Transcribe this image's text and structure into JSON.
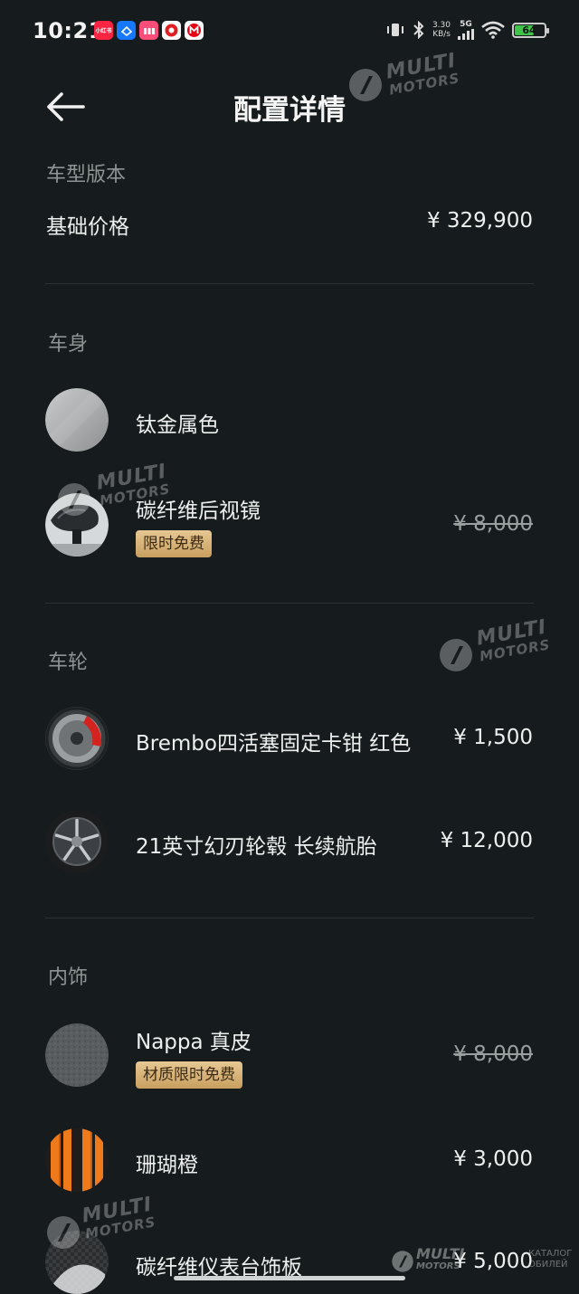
{
  "status_bar": {
    "time": "10:21",
    "apps": [
      {
        "name": "小红书",
        "color": "#ff2442"
      },
      {
        "name": "APP",
        "color": "#1677ff"
      },
      {
        "name": "app",
        "color": "#ff4d7a"
      },
      {
        "name": "app",
        "color": "#e02020"
      },
      {
        "name": "M",
        "color": "#e60012"
      }
    ],
    "net_speed_top": "3.30",
    "net_speed_unit": "KB/s",
    "signal": "5G",
    "battery": "64"
  },
  "header": {
    "title": "配置详情"
  },
  "trim": {
    "section": "车型版本",
    "base_price_label": "基础价格",
    "base_price": "¥ 329,900"
  },
  "body": {
    "section": "车身",
    "items": [
      {
        "label": "钛金属色",
        "price": ""
      },
      {
        "label": "碳纤维后视镜",
        "price": "¥ 8,000",
        "badge": "限时免费"
      }
    ]
  },
  "wheels": {
    "section": "车轮",
    "items": [
      {
        "label": "Brembo四活塞固定卡钳 红色",
        "price": "¥ 1,500"
      },
      {
        "label": "21英寸幻刃轮毂 长续航胎",
        "price": "¥ 12,000"
      }
    ]
  },
  "interior": {
    "section": "内饰",
    "items": [
      {
        "label": "Nappa 真皮",
        "price": "¥ 8,000",
        "badge": "材质限时免费"
      },
      {
        "label": "珊瑚橙",
        "price": "¥ 3,000"
      },
      {
        "label": "碳纤维仪表台饰板",
        "price": "¥ 5,000"
      }
    ]
  },
  "watermark": {
    "line1": "MULTI",
    "line2": "MOTORS",
    "caption_line1": "КАТАЛОГ",
    "caption_line2": "ОБИЛЕЙ"
  }
}
